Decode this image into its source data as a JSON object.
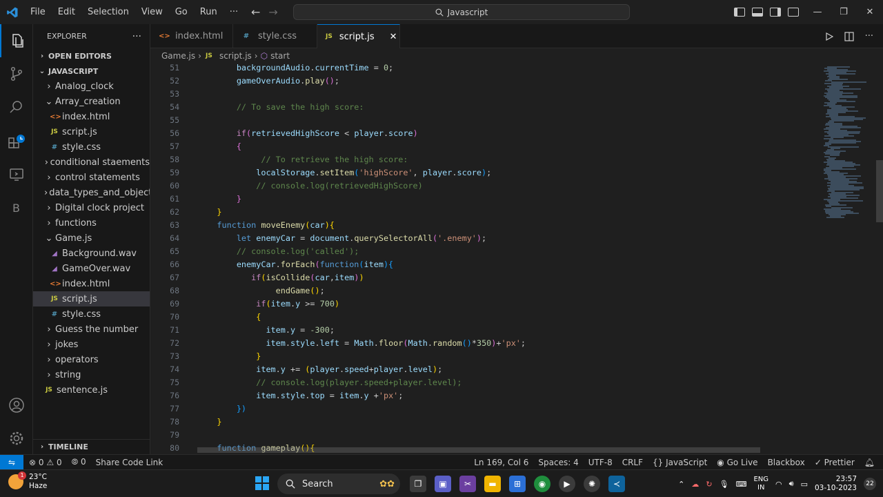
{
  "titlebar": {
    "menu": [
      "File",
      "Edit",
      "Selection",
      "View",
      "Go",
      "Run",
      "···"
    ],
    "search_text": "Javascript",
    "controls": [
      "—",
      "❐",
      "✕"
    ]
  },
  "sidebar": {
    "title": "EXPLORER",
    "more": "···",
    "open_editors": "OPEN EDITORS",
    "root": "JAVASCRIPT",
    "items": [
      {
        "label": "Analog_clock",
        "depth": 1,
        "type": "folder-closed"
      },
      {
        "label": "Array_creation",
        "depth": 1,
        "type": "folder-open"
      },
      {
        "label": "index.html",
        "depth": 2,
        "type": "html"
      },
      {
        "label": "script.js",
        "depth": 2,
        "type": "js"
      },
      {
        "label": "style.css",
        "depth": 2,
        "type": "css"
      },
      {
        "label": "conditional staements",
        "depth": 1,
        "type": "folder-closed"
      },
      {
        "label": "control statements",
        "depth": 1,
        "type": "folder-closed"
      },
      {
        "label": "data_types_and_object",
        "depth": 1,
        "type": "folder-closed"
      },
      {
        "label": "Digital clock project",
        "depth": 1,
        "type": "folder-closed"
      },
      {
        "label": "functions",
        "depth": 1,
        "type": "folder-closed"
      },
      {
        "label": "Game.js",
        "depth": 1,
        "type": "folder-open"
      },
      {
        "label": "Background.wav",
        "depth": 2,
        "type": "wav"
      },
      {
        "label": "GameOver.wav",
        "depth": 2,
        "type": "wav"
      },
      {
        "label": "index.html",
        "depth": 2,
        "type": "html"
      },
      {
        "label": "script.js",
        "depth": 2,
        "type": "js",
        "selected": true
      },
      {
        "label": "style.css",
        "depth": 2,
        "type": "css"
      },
      {
        "label": "Guess the number",
        "depth": 1,
        "type": "folder-closed"
      },
      {
        "label": "jokes",
        "depth": 1,
        "type": "folder-closed"
      },
      {
        "label": "operators",
        "depth": 1,
        "type": "folder-closed"
      },
      {
        "label": "string",
        "depth": 1,
        "type": "folder-closed"
      },
      {
        "label": "sentence.js",
        "depth": 1,
        "type": "js"
      }
    ],
    "timeline": "TIMELINE"
  },
  "tabs": [
    {
      "label": "index.html",
      "icon": "html",
      "active": false
    },
    {
      "label": "style.css",
      "icon": "css",
      "active": false
    },
    {
      "label": "script.js",
      "icon": "js",
      "active": true
    }
  ],
  "breadcrumb": [
    "Game.js",
    "script.js",
    "start"
  ],
  "editor": {
    "line_numbers": [
      "51",
      "52",
      "53",
      "54",
      "55",
      "56",
      "57",
      "58",
      "59",
      "60",
      "61",
      "62",
      "63",
      "64",
      "65",
      "66",
      "67",
      "68",
      "69",
      "70",
      "71",
      "72",
      "73",
      "74",
      "75",
      "76",
      "77",
      "78",
      "79",
      "80"
    ]
  },
  "statusbar": {
    "errors": "0",
    "warnings": "0",
    "ports": "0",
    "share": "Share Code Link",
    "position": "Ln 169, Col 6",
    "spaces": "Spaces: 4",
    "encoding": "UTF-8",
    "eol": "CRLF",
    "language": "JavaScript",
    "golive": "Go Live",
    "blackbox": "Blackbox",
    "prettier": "Prettier"
  },
  "taskbar": {
    "temp": "23°C",
    "condition": "Haze",
    "weather_badge": "1",
    "search": "Search",
    "lang_top": "ENG",
    "lang_bottom": "IN",
    "time": "23:57",
    "date": "03-10-2023",
    "notif_count": "22"
  },
  "colors": {
    "accent": "#0078d4",
    "keyword": "#569cd6",
    "function": "#dcdcaa",
    "variable": "#9cdcfe",
    "string": "#ce9178",
    "number": "#b5cea8",
    "comment": "#6a9955"
  }
}
